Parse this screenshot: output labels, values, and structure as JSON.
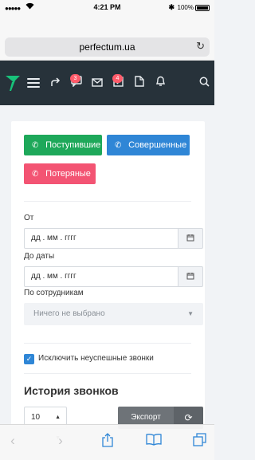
{
  "status_bar": {
    "time": "4:21 PM",
    "battery": "100%"
  },
  "browser": {
    "url": "perfectum.ua"
  },
  "app_nav": {
    "icons": [
      "logo-icon",
      "menu-icon",
      "share-icon",
      "chat-icon",
      "mail-icon",
      "tasks-icon",
      "document-icon",
      "bell-icon",
      "search-icon"
    ],
    "chat_badge": "3",
    "tasks_badge": "4"
  },
  "filters": {
    "btn_incoming": "Поступившие",
    "btn_completed": "Совершенные",
    "btn_lost": "Потеряные",
    "from_label": "От",
    "from_placeholder": "дд . мм . гггг",
    "to_label": "До даты",
    "to_placeholder": "дд . мм . гггг",
    "employees_label": "По сотрудникам",
    "employees_value": "Ничего не выбрано",
    "exclude_failed_label": "Исключить неуспешные звонки",
    "exclude_failed_checked": true
  },
  "history": {
    "title": "История звонков",
    "page_size": "10",
    "export_label": "Экспорт"
  },
  "colors": {
    "nav_bg": "#27323a",
    "green": "#1ea85a",
    "blue": "#2f86d6",
    "red": "#f35473",
    "export": "#6e7378"
  },
  "safari_toolbar": [
    "back-icon",
    "forward-icon",
    "share-icon",
    "bookmarks-icon",
    "tabs-icon"
  ]
}
